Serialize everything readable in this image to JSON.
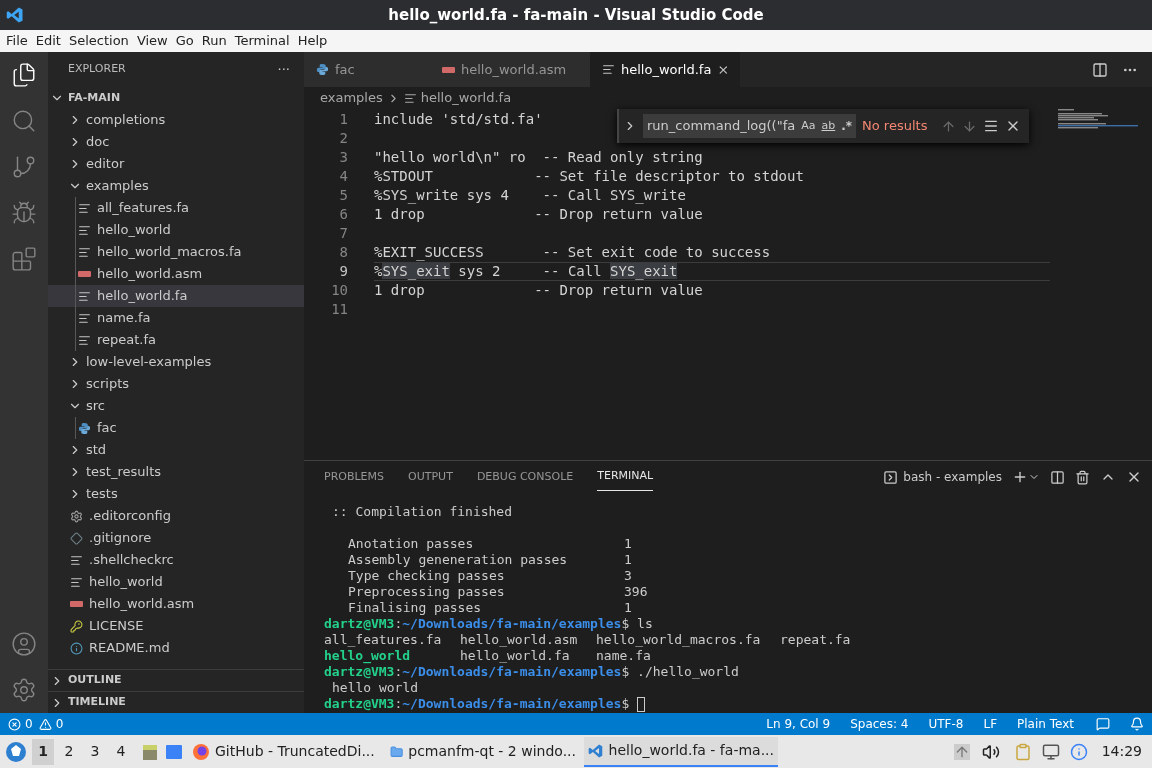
{
  "window": {
    "title": "hello_world.fa - fa-main - Visual Studio Code"
  },
  "menu": [
    "File",
    "Edit",
    "Selection",
    "View",
    "Go",
    "Run",
    "Terminal",
    "Help"
  ],
  "sidebar": {
    "title": "EXPLORER",
    "more": "···",
    "root": {
      "name": "FA-MAIN",
      "expanded": true,
      "children": [
        {
          "name": "completions",
          "kind": "folder",
          "expanded": false
        },
        {
          "name": "doc",
          "kind": "folder",
          "expanded": false
        },
        {
          "name": "editor",
          "kind": "folder",
          "expanded": false
        },
        {
          "name": "examples",
          "kind": "folder",
          "expanded": true,
          "children": [
            {
              "name": "all_features.fa",
              "kind": "text",
              "selected": false
            },
            {
              "name": "hello_world",
              "kind": "text",
              "selected": false
            },
            {
              "name": "hello_world_macros.fa",
              "kind": "text",
              "selected": false
            },
            {
              "name": "hello_world.asm",
              "kind": "asm",
              "selected": false
            },
            {
              "name": "hello_world.fa",
              "kind": "text",
              "selected": true
            },
            {
              "name": "name.fa",
              "kind": "text",
              "selected": false
            },
            {
              "name": "repeat.fa",
              "kind": "text",
              "selected": false
            }
          ]
        },
        {
          "name": "low-level-examples",
          "kind": "folder",
          "expanded": false
        },
        {
          "name": "scripts",
          "kind": "folder",
          "expanded": false
        },
        {
          "name": "src",
          "kind": "folder",
          "expanded": true,
          "children": [
            {
              "name": "fac",
              "kind": "python",
              "selected": false
            }
          ]
        },
        {
          "name": "std",
          "kind": "folder",
          "expanded": false
        },
        {
          "name": "test_results",
          "kind": "folder",
          "expanded": false
        },
        {
          "name": "tests",
          "kind": "folder",
          "expanded": false
        },
        {
          "name": ".editorconfig",
          "kind": "gear",
          "selected": false
        },
        {
          "name": ".gitignore",
          "kind": "diamond",
          "selected": false
        },
        {
          "name": ".shellcheckrc",
          "kind": "text",
          "selected": false
        },
        {
          "name": "hello_world",
          "kind": "text",
          "selected": false
        },
        {
          "name": "hello_world.asm",
          "kind": "asm",
          "selected": false
        },
        {
          "name": "LICENSE",
          "kind": "key",
          "selected": false
        },
        {
          "name": "README.md",
          "kind": "info",
          "selected": false
        }
      ]
    },
    "sections": [
      {
        "title": "OUTLINE",
        "expanded": false
      },
      {
        "title": "TIMELINE",
        "expanded": false
      }
    ]
  },
  "tabs": [
    {
      "label": "fac",
      "kind": "python",
      "selected": false
    },
    {
      "label": "hello_world.asm",
      "kind": "asm",
      "selected": false
    },
    {
      "label": "hello_world.fa",
      "kind": "text",
      "selected": true
    }
  ],
  "breadcrumb": [
    "examples",
    "hello_world.fa"
  ],
  "find": {
    "value": "run_command_log((\"fa",
    "match_case": "Aa",
    "whole_word": "ab",
    "regex": ".*",
    "result": "No results"
  },
  "code": [
    {
      "number": "1",
      "current": false,
      "parts": [
        {
          "text": "include 'std/std.fa'",
          "highlight": false
        }
      ]
    },
    {
      "number": "2",
      "current": false
    },
    {
      "number": "3",
      "current": false,
      "parts": [
        {
          "text": "\"hello world\\n\" ro  -- Read only string",
          "highlight": false
        }
      ]
    },
    {
      "number": "4",
      "current": false,
      "parts": [
        {
          "text": "%STDOUT            -- Set file descriptor to stdout",
          "highlight": false
        }
      ]
    },
    {
      "number": "5",
      "current": false,
      "parts": [
        {
          "text": "%SYS_write sys 4    -- Call SYS_write",
          "highlight": false
        }
      ]
    },
    {
      "number": "6",
      "current": false,
      "parts": [
        {
          "text": "1 drop             -- Drop return value",
          "highlight": false
        }
      ]
    },
    {
      "number": "7",
      "current": false
    },
    {
      "number": "8",
      "current": false,
      "parts": [
        {
          "text": "%EXIT_SUCCESS       -- Set exit code to success",
          "highlight": false
        }
      ]
    },
    {
      "number": "9",
      "current": true,
      "parts": [
        {
          "text": "%",
          "highlight": false
        },
        {
          "text": "SYS_exit",
          "highlight": true
        },
        {
          "text": " sys 2     -- Call ",
          "highlight": false
        },
        {
          "text": "SYS_exit",
          "highlight": true
        }
      ]
    },
    {
      "number": "10",
      "current": false,
      "parts": [
        {
          "text": "1 drop             -- Drop return value",
          "highlight": false
        }
      ]
    },
    {
      "number": "11",
      "current": false
    }
  ],
  "panel": {
    "tabs": [
      {
        "label": "PROBLEMS",
        "selected": false
      },
      {
        "label": "OUTPUT",
        "selected": false
      },
      {
        "label": "DEBUG CONSOLE",
        "selected": false
      },
      {
        "label": "TERMINAL",
        "selected": true
      }
    ],
    "terminal_name": "bash - examples",
    "lines": [
      {
        "kind": "note",
        "segments": [
          {
            "text": ":: Compilation finished",
            "kind": "plain"
          }
        ]
      },
      {
        "kind": "stat",
        "spacer": true,
        "segments": [
          {
            "text": "Anotation passes",
            "kind": "plain"
          },
          {
            "text": "1",
            "kind": "plain"
          }
        ]
      },
      {
        "kind": "stat",
        "spacer": false,
        "segments": [
          {
            "text": "Assembly geneneration passes",
            "kind": "plain"
          },
          {
            "text": "1",
            "kind": "plain"
          }
        ]
      },
      {
        "kind": "stat",
        "spacer": false,
        "segments": [
          {
            "text": "Type checking passes",
            "kind": "plain"
          },
          {
            "text": "3",
            "kind": "plain"
          }
        ]
      },
      {
        "kind": "stat",
        "spacer": false,
        "segments": [
          {
            "text": "Preprocessing passes",
            "kind": "plain"
          },
          {
            "text": "396",
            "kind": "plain"
          }
        ]
      },
      {
        "kind": "stat",
        "spacer": false,
        "segments": [
          {
            "text": "Finalising passes",
            "kind": "plain"
          },
          {
            "text": "1",
            "kind": "plain"
          }
        ]
      },
      {
        "kind": "prompt",
        "segments": [
          {
            "text": "dartz@VM3",
            "kind": "user"
          },
          {
            "text": ":",
            "kind": "plain"
          },
          {
            "text": "~/Downloads/fa-main/examples",
            "kind": "path"
          },
          {
            "text": "$ ls",
            "kind": "plain"
          }
        ]
      },
      {
        "kind": "columns",
        "segments": [
          {
            "text": "all_features.fa",
            "kind": "plain"
          },
          {
            "text": "hello_world.asm",
            "kind": "plain"
          },
          {
            "text": "hello_world_macros.fa",
            "kind": "plain"
          },
          {
            "text": "repeat.fa",
            "kind": "plain"
          }
        ]
      },
      {
        "kind": "columns",
        "segments": [
          {
            "text": "hello_world",
            "kind": "user"
          },
          {
            "text": "hello_world.fa",
            "kind": "plain"
          },
          {
            "text": "name.fa",
            "kind": "plain"
          }
        ]
      },
      {
        "kind": "prompt",
        "segments": [
          {
            "text": "dartz@VM3",
            "kind": "user"
          },
          {
            "text": ":",
            "kind": "plain"
          },
          {
            "text": "~/Downloads/fa-main/examples",
            "kind": "path"
          },
          {
            "text": "$ ./hello_world",
            "kind": "plain"
          }
        ]
      },
      {
        "kind": "note",
        "segments": [
          {
            "text": "hello world",
            "kind": "plain"
          }
        ]
      },
      {
        "kind": "prompt",
        "cursor": true,
        "segments": [
          {
            "text": "dartz@VM3",
            "kind": "user"
          },
          {
            "text": ":",
            "kind": "plain"
          },
          {
            "text": "~/Downloads/fa-main/examples",
            "kind": "path"
          },
          {
            "text": "$",
            "kind": "plain"
          }
        ]
      }
    ]
  },
  "status_bar": {
    "errors": "0",
    "warnings": "0",
    "right": [
      "Ln 9, Col 9",
      "Spaces: 4",
      "UTF-8",
      "LF",
      "Plain Text"
    ]
  },
  "taskbar": {
    "workspaces": [
      {
        "label": "1",
        "selected": true
      },
      {
        "label": "2",
        "selected": false
      },
      {
        "label": "3",
        "selected": false
      },
      {
        "label": "4",
        "selected": false
      }
    ],
    "windows": [
      {
        "label": "GitHub - TruncatedDi...",
        "kind": "browser",
        "selected": false
      },
      {
        "label": "pcmanfm-qt - 2 windo...",
        "kind": "folder",
        "selected": false
      },
      {
        "label": "hello_world.fa - fa-ma...",
        "kind": "code",
        "selected": true
      }
    ],
    "clock": "14:29"
  }
}
